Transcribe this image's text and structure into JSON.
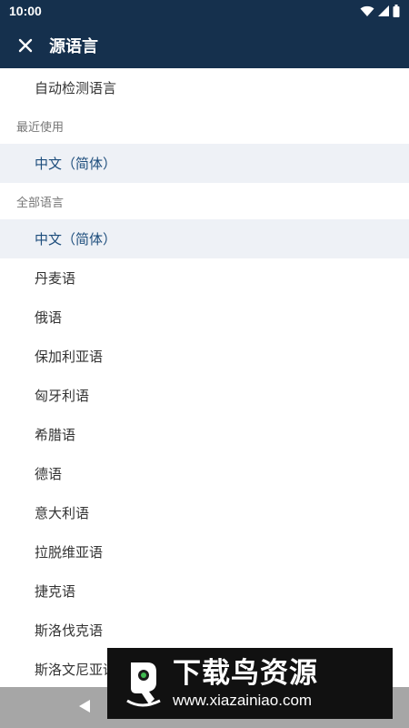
{
  "status": {
    "time": "10:00"
  },
  "appbar": {
    "title": "源语言"
  },
  "auto_detect": "自动检测语言",
  "recent": {
    "header": "最近使用",
    "items": [
      "中文（简体）"
    ]
  },
  "all": {
    "header": "全部语言",
    "items": [
      "中文（简体）",
      "丹麦语",
      "俄语",
      "保加利亚语",
      "匈牙利语",
      "希腊语",
      "德语",
      "意大利语",
      "拉脱维亚语",
      "捷克语",
      "斯洛伐克语",
      "斯洛文尼亚语"
    ]
  },
  "watermark": {
    "title": "下载鸟资源",
    "url": "www.xiazainiao.com"
  },
  "colors": {
    "appbar": "#15304d",
    "selected_bg": "#eef1f6",
    "selected_text": "#1d4d7c"
  }
}
